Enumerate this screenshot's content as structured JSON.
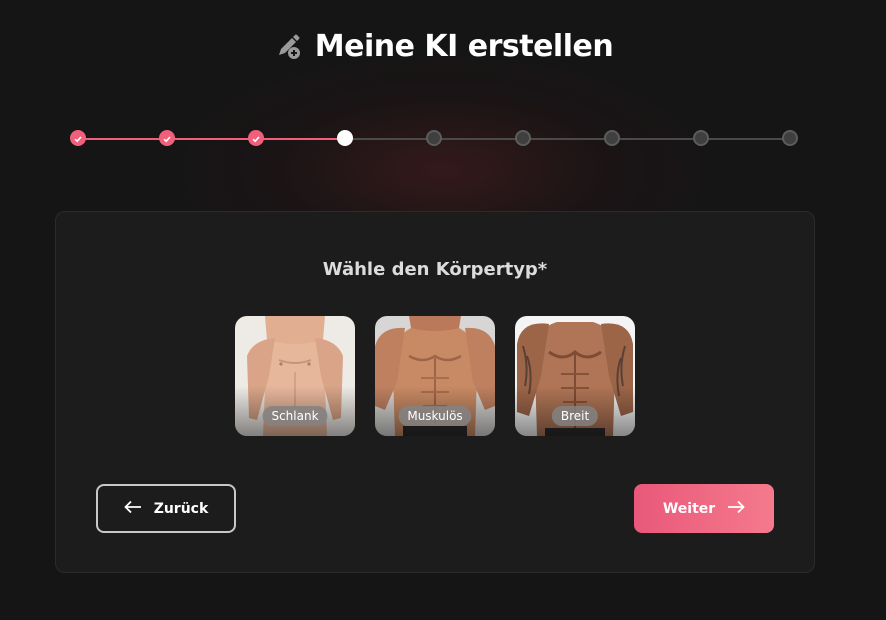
{
  "header": {
    "title": "Meine KI erstellen",
    "icon": "pen-plus-icon"
  },
  "stepper": {
    "total_steps": 9,
    "completed_steps": 3,
    "current_step": 4,
    "done_color": "#f0607a",
    "todo_color": "#4a4a4a"
  },
  "question": {
    "label": "Wähle den Körpertyp*"
  },
  "options": [
    {
      "label": "Schlank"
    },
    {
      "label": "Muskulös"
    },
    {
      "label": "Breit"
    }
  ],
  "nav": {
    "back_label": "Zurück",
    "back_icon": "arrow-left-icon",
    "next_label": "Weiter",
    "next_icon": "arrow-right-icon",
    "accent": "#f06a84"
  }
}
